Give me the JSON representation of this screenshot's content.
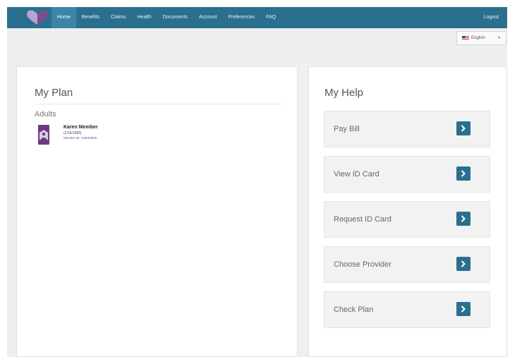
{
  "nav": {
    "items": [
      {
        "label": "Home"
      },
      {
        "label": "Benefits"
      },
      {
        "label": "Claims"
      },
      {
        "label": "Health"
      },
      {
        "label": "Documents"
      },
      {
        "label": "Account"
      },
      {
        "label": "Preferences"
      },
      {
        "label": "FAQ"
      }
    ],
    "active": "Home",
    "logout_label": "Logout"
  },
  "language": {
    "selected": "English",
    "icon": "us-flag-icon"
  },
  "my_plan": {
    "title": "My Plan",
    "section_label": "Adults",
    "members": [
      {
        "name": "Karen Member",
        "dob": "(1/15/1965)",
        "member_id": "Member ID: 100000000"
      }
    ]
  },
  "my_help": {
    "title": "My Help",
    "items": [
      {
        "label": "Pay Bill"
      },
      {
        "label": "View ID Card"
      },
      {
        "label": "Request ID Card"
      },
      {
        "label": "Choose Provider"
      },
      {
        "label": "Check Plan"
      }
    ]
  },
  "colors": {
    "nav_bg": "#2a6f8e",
    "nav_active": "#3b86a8",
    "button_bg": "#2a6f8e",
    "avatar_bg": "#6b3a82"
  }
}
